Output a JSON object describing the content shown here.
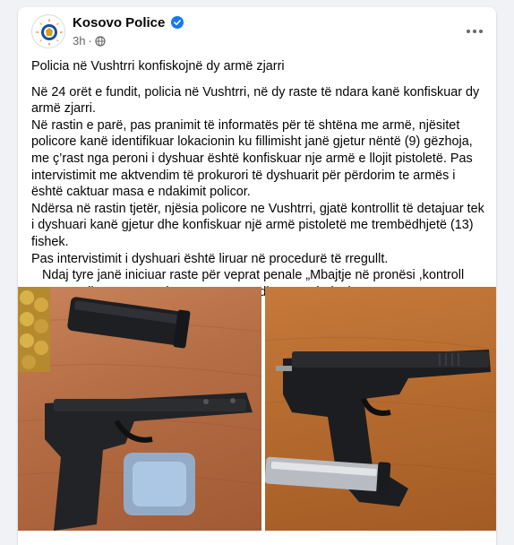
{
  "post": {
    "author": "Kosovo Police",
    "time": "3h",
    "dot": "·",
    "title": "Policia në Vushtrri konfiskojnë dy armë zjarri",
    "paragraphs": [
      "Në 24 orët e  fundit, policia në Vushtrri, në dy  raste të ndara  kanë konfiskuar dy armë zjarri.",
      "Në rastin e parë, pas pranimit të informatës për të shtëna me armë, njësitet policore kanë identifikuar lokacionin ku fillimisht janë gjetur  nëntë (9) gëzhoja, me ç’rast nga peroni i dyshuar është konfiskuar nje armë e llojit pistoletë. Pas intervistimit me aktvendim të prokurori të dyshuarit për përdorim te armës i është caktuar masa  e ndakimit policor.",
      "Ndërsa në rastin tjetër, njësia policore ne Vushtrri, gjatë kontrollit të detajuar tek i dyshuari kanë gjetur dhe konfiskuar një armë pistoletë me trembëdhjetë (13) fishek.",
      "Pas intervistimit i dyshuari është liruar në procedurë të rregullt.",
      "   Ndaj tyre janë iniciuar raste për veprat penale „Mbajtje në pronësi ,kontroll ose posedim të paautorizuar të armëve”dhe “ Përdorim i armës‘."
    ]
  },
  "icons": {
    "verified": "verified-badge-icon",
    "privacy": "globe-icon",
    "more": "more-options-icon"
  },
  "colors": {
    "verified": "#1877f2",
    "secondary_text": "#65676b"
  }
}
